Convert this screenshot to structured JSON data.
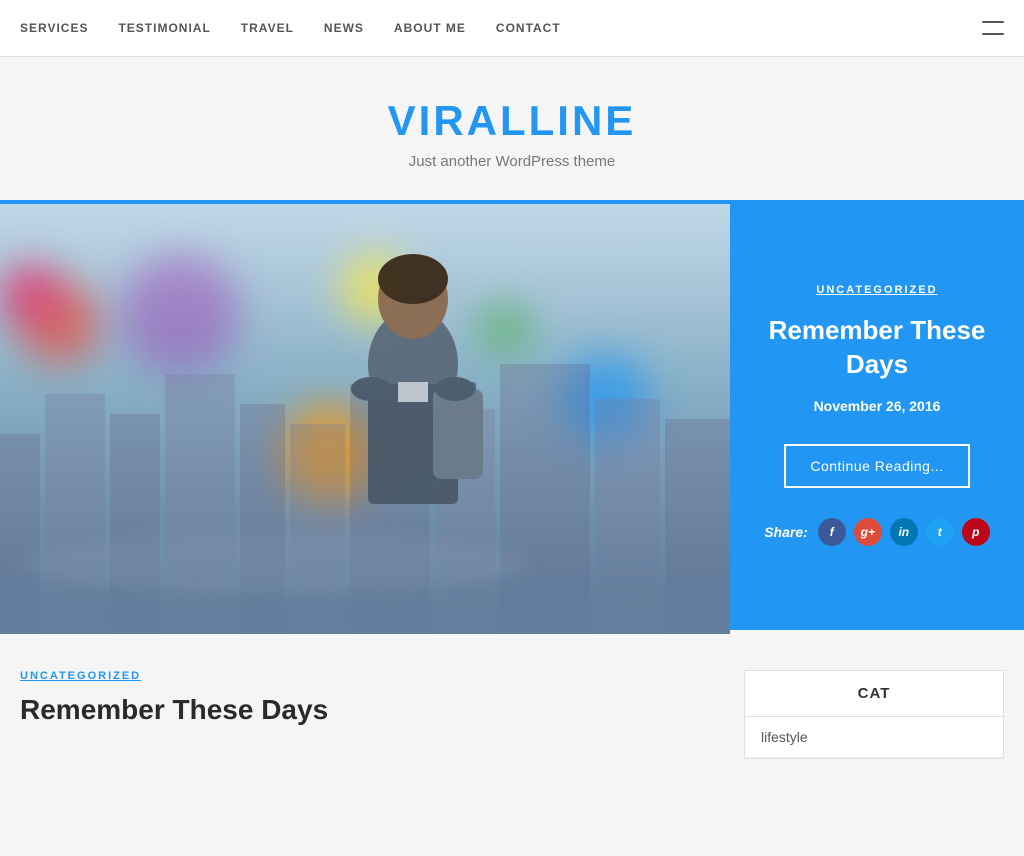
{
  "nav": {
    "items": [
      {
        "label": "SERVICES",
        "name": "nav-services"
      },
      {
        "label": "TESTIMONIAL",
        "name": "nav-testimonial"
      },
      {
        "label": "TRAVEL",
        "name": "nav-travel"
      },
      {
        "label": "NEWS",
        "name": "nav-news"
      },
      {
        "label": "ABOUT ME",
        "name": "nav-about"
      },
      {
        "label": "CONTACT",
        "name": "nav-contact"
      }
    ]
  },
  "site": {
    "title": "VIRALLINE",
    "tagline": "Just another WordPress theme"
  },
  "featured": {
    "category": "UNCATEGORIZED",
    "title": "Remember These Days",
    "date": "November 26, 2016",
    "continue_btn": "Continue Reading...",
    "share_label": "Share:"
  },
  "post": {
    "category": "UNCATEGORIZED",
    "title": "Remember These Days"
  },
  "sidebar": {
    "widget_title": "CAT",
    "items": [
      {
        "label": "lifestyle"
      }
    ]
  }
}
